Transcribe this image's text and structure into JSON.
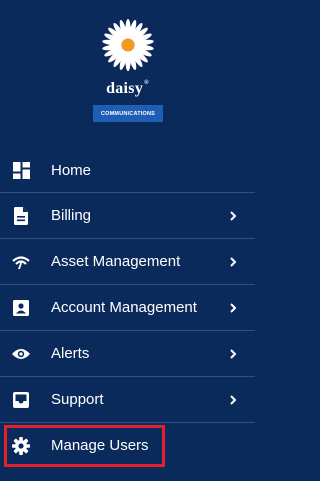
{
  "brand": {
    "name": "daisy",
    "mark": "®",
    "subtitle": "COMMUNICATIONS",
    "logo_icon": "daisy-flower-logo",
    "colors": {
      "background": "#0b2a5c",
      "badge": "#1e5fb5",
      "petal": "#ffffff",
      "center": "#f39a1f",
      "highlight": "#e4212b",
      "divider": "#34507f"
    }
  },
  "menu": {
    "items": [
      {
        "label": "Home",
        "icon": "dashboard-icon",
        "has_submenu": false
      },
      {
        "label": "Billing",
        "icon": "document-icon",
        "has_submenu": true
      },
      {
        "label": "Asset Management",
        "icon": "signal-icon",
        "has_submenu": true
      },
      {
        "label": "Account Management",
        "icon": "contact-card-icon",
        "has_submenu": true
      },
      {
        "label": "Alerts",
        "icon": "eye-icon",
        "has_submenu": true
      },
      {
        "label": "Support",
        "icon": "inbox-icon",
        "has_submenu": true
      },
      {
        "label": "Manage Users",
        "icon": "gear-icon",
        "has_submenu": false,
        "highlighted": true
      }
    ]
  }
}
